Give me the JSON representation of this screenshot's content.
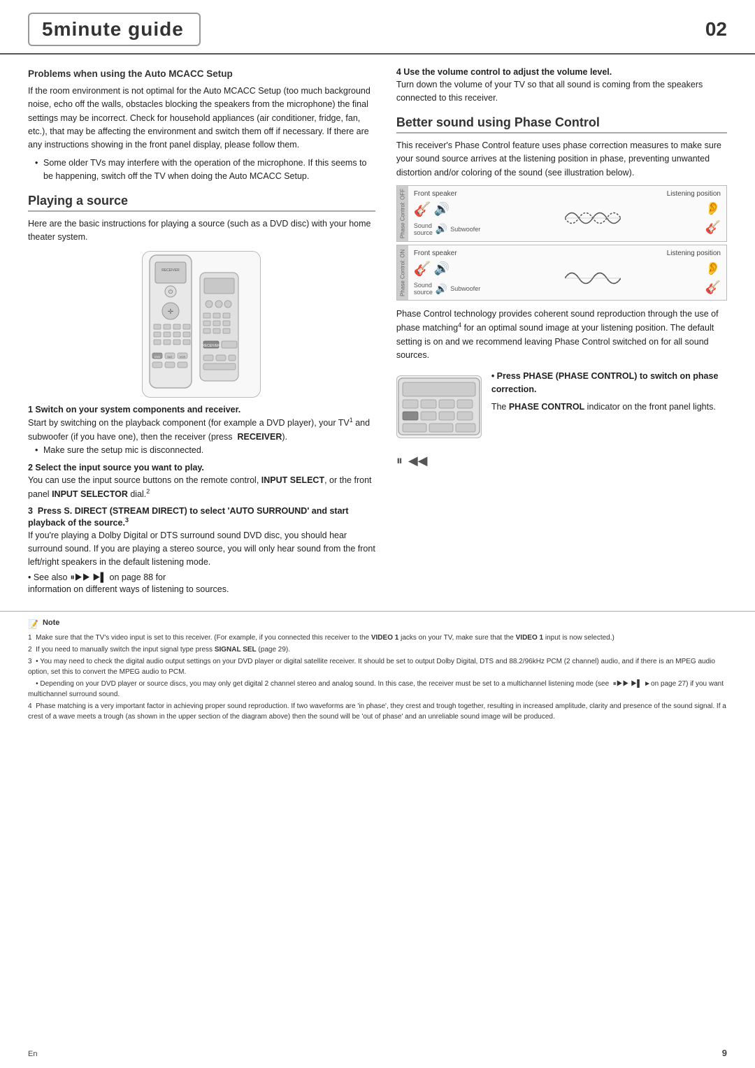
{
  "header": {
    "title": "5minute guide",
    "page_number": "02"
  },
  "left_column": {
    "problems_heading": "Problems when using the Auto MCACC Setup",
    "problems_body": "If the room environment is not optimal for the Auto MCACC Setup (too much background noise, echo off the walls, obstacles blocking the speakers from the microphone) the final settings may be incorrect. Check for household appliances (air conditioner, fridge, fan, etc.), that may be affecting the environment and switch them off if necessary. If there are any instructions showing in the front panel display, please follow them.",
    "bullet_1": "Some older TVs may interfere with the operation of the microphone. If this seems to be happening, switch off the TV when doing the Auto MCACC Setup.",
    "playing_heading": "Playing a source",
    "playing_body": "Here are the basic instructions for playing a source (such as a DVD disc) with your home theater system.",
    "step1_title": "1   Switch on your system components and receiver.",
    "step1_body": "Start by switching on the playback component (for example a DVD player), your TV",
    "step1_sup": "1",
    "step1_body2": " and subwoofer (if you have one), then the receiver (press",
    "step1_receiver": "RECEIVER",
    "step1_body3": ").",
    "step1_bullet": "Make sure the setup mic is disconnected.",
    "step2_title": "2   Select the input source you want to play.",
    "step2_body": "You can use the input source buttons on the remote control, INPUT SELECT, or the front panel INPUT SELECTOR dial.",
    "step2_sup": "2",
    "step3_title": "3   Press S. DIRECT (STREAM DIRECT) to select 'AUTO SURROUND' and start playback of the source.",
    "step3_sup": "3",
    "step3_body": "If you're playing a Dolby Digital or DTS surround sound DVD disc, you should hear surround sound. If you are playing a stereo source, you will only hear sound from the front left/right speakers in the default listening mode.",
    "see_also_prefix": "• See also",
    "see_also_suffix": "on page",
    "see_also_page": "88",
    "see_also_for": "for",
    "see_also_info": "information on different ways of listening to sources."
  },
  "right_column": {
    "step4_title": "4   Use the volume control to adjust the volume level.",
    "step4_body": "Turn down the volume of your TV so that all sound is coming from the speakers connected to this receiver.",
    "better_sound_heading": "Better sound using Phase Control",
    "better_sound_body": "This receiver's Phase Control feature uses phase correction measures to make sure your sound source arrives at the listening position in phase, preventing unwanted distortion and/or coloring of the sound (see illustration below).",
    "diag1": {
      "label_bar": "Phase Control: OFF",
      "front_speaker": "Front speaker",
      "listening_position": "Listening position",
      "sound_source": "Sound source",
      "subwoofer": "Subwoofer"
    },
    "diag2": {
      "label_bar": "Phase Control: ON",
      "front_speaker": "Front speaker",
      "listening_position": "Listening position",
      "sound_source": "Sound source",
      "subwoofer": "Subwoofer"
    },
    "phase_body": "Phase Control technology provides coherent sound reproduction through the use of phase matching",
    "phase_sup": "4",
    "phase_body2": " for an optimal sound image at your listening position. The default setting is on and we recommend leaving Phase Control switched on for all sound sources.",
    "press_phase_label": "• Press PHASE (PHASE CONTROL) to switch on phase correction.",
    "phase_indicator": "The PHASE CONTROL indicator on the front panel lights."
  },
  "footer": {
    "note_header": "Note",
    "notes": [
      "1  Make sure that the TV's video input is set to this receiver. (For example, if you connected this receiver to the VIDEO 1 jacks on your TV, make sure that the VIDEO 1 input is now selected.)",
      "2  If you need to manually switch the input signal type press SIGNAL SEL (page 29).",
      "3  • You may need to check the digital audio output settings on your DVD player or digital satellite receiver. It should be set to output Dolby Digital, DTS and 88.2/96kHz PCM (2 channel) audio, and if there is an MPEG audio option, set this to convert the MPEG audio to PCM.",
      "   • Depending on your DVD player or source discs, you may only get digital 2 channel stereo and analog sound. In this case, the receiver must be set to a multichannel listening mode (see ►on page 27) if you want multichannel surround sound.",
      "4  Phase matching is a very important factor in achieving proper sound reproduction. If two waveforms are 'in phase', they crest and trough together, resulting in increased amplitude, clarity and presence of the sound signal. If a crest of a wave meets a trough (as shown in the upper section of the diagram above) then the sound will be 'out of phase' and an unreliable sound image will be produced."
    ]
  },
  "page_number_bottom": "9",
  "page_en": "En"
}
